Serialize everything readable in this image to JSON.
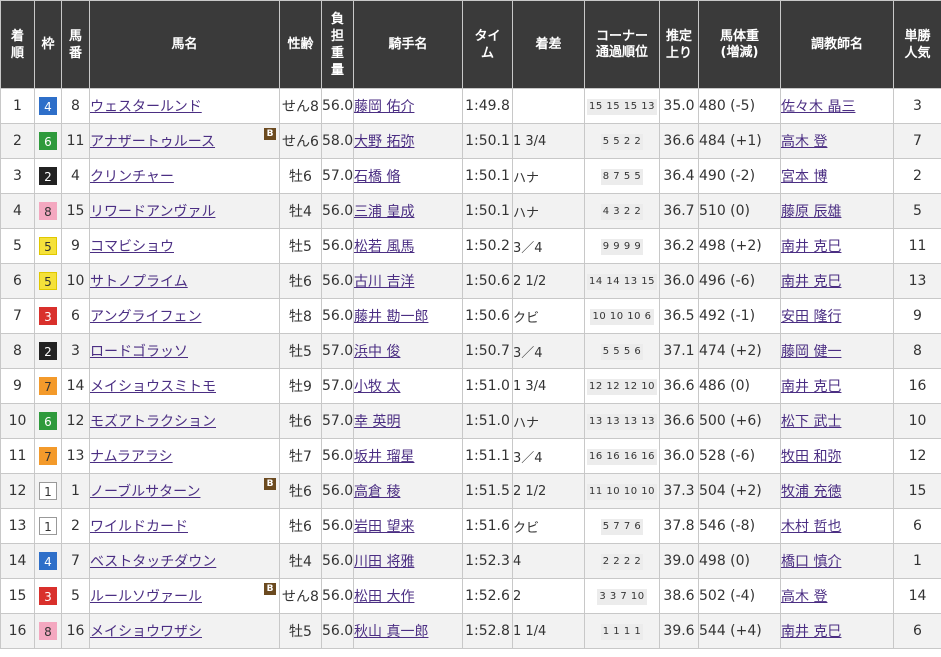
{
  "headers": {
    "finish": "着順",
    "frame": "枠",
    "number": "馬番",
    "horse": "馬名",
    "sex_age": "性齢",
    "weight": "負担重量",
    "jockey": "騎手名",
    "time": "タイム",
    "margin": "着差",
    "passing_line1": "コーナー",
    "passing_line2": "通過順位",
    "last3f": "推定上り",
    "body_line1": "馬体重",
    "body_line2": "(増減)",
    "trainer": "調教師名",
    "popularity": "単勝人気"
  },
  "frame_colors": {
    "1": {
      "bg": "#ffffff",
      "fg": "#333333",
      "border": "#999999"
    },
    "2": {
      "bg": "#222222",
      "fg": "#ffffff",
      "border": "#222222"
    },
    "3": {
      "bg": "#d9302c",
      "fg": "#ffffff",
      "border": "#d9302c"
    },
    "4": {
      "bg": "#2e6fc9",
      "fg": "#ffffff",
      "border": "#2e6fc9"
    },
    "5": {
      "bg": "#f5e13a",
      "fg": "#333333",
      "border": "#e0c800"
    },
    "6": {
      "bg": "#2e9a3c",
      "fg": "#ffffff",
      "border": "#2e9a3c"
    },
    "7": {
      "bg": "#f39a2b",
      "fg": "#333333",
      "border": "#f39a2b"
    },
    "8": {
      "bg": "#f4a8c0",
      "fg": "#333333",
      "border": "#f4a8c0"
    }
  },
  "blinker_label": "B",
  "rows": [
    {
      "finish": "1",
      "frame": "4",
      "number": "8",
      "horse": "ウェスタールンド",
      "blinker": false,
      "sex_age": "せん8",
      "weight": "56.0",
      "jockey": "藤岡 佑介",
      "time": "1:49.8",
      "margin": "",
      "passing": "15 15 15 13",
      "last3f": "35.0",
      "body": "480 (-5)",
      "trainer": "佐々木 晶三",
      "popularity": "3"
    },
    {
      "finish": "2",
      "frame": "6",
      "number": "11",
      "horse": "アナザートゥルース",
      "blinker": true,
      "sex_age": "せん6",
      "weight": "58.0",
      "jockey": "大野 拓弥",
      "time": "1:50.1",
      "margin": "1 3/4",
      "passing": "5 5 2 2",
      "last3f": "36.6",
      "body": "484 (+1)",
      "trainer": "高木 登",
      "popularity": "7"
    },
    {
      "finish": "3",
      "frame": "2",
      "number": "4",
      "horse": "クリンチャー",
      "blinker": false,
      "sex_age": "牡6",
      "weight": "57.0",
      "jockey": "石橋 脩",
      "time": "1:50.1",
      "margin": "ハナ",
      "passing": "8 7 5 5",
      "last3f": "36.4",
      "body": "490 (-2)",
      "trainer": "宮本 博",
      "popularity": "2"
    },
    {
      "finish": "4",
      "frame": "8",
      "number": "15",
      "horse": "リワードアンヴァル",
      "blinker": false,
      "sex_age": "牡4",
      "weight": "56.0",
      "jockey": "三浦 皇成",
      "time": "1:50.1",
      "margin": "ハナ",
      "passing": "4 3 2 2",
      "last3f": "36.7",
      "body": "510 (0)",
      "trainer": "藤原 辰雄",
      "popularity": "5"
    },
    {
      "finish": "5",
      "frame": "5",
      "number": "9",
      "horse": "コマビショウ",
      "blinker": false,
      "sex_age": "牡5",
      "weight": "56.0",
      "jockey": "松若 風馬",
      "time": "1:50.2",
      "margin": "3／4",
      "passing": "9 9 9 9",
      "last3f": "36.2",
      "body": "498 (+2)",
      "trainer": "南井 克巳",
      "popularity": "11"
    },
    {
      "finish": "6",
      "frame": "5",
      "number": "10",
      "horse": "サトノプライム",
      "blinker": false,
      "sex_age": "牡6",
      "weight": "56.0",
      "jockey": "古川 吉洋",
      "time": "1:50.6",
      "margin": "2 1/2",
      "passing": "14 14 13 15",
      "last3f": "36.0",
      "body": "496 (-6)",
      "trainer": "南井 克巳",
      "popularity": "13"
    },
    {
      "finish": "7",
      "frame": "3",
      "number": "6",
      "horse": "アングライフェン",
      "blinker": false,
      "sex_age": "牡8",
      "weight": "56.0",
      "jockey": "藤井 勘一郎",
      "time": "1:50.6",
      "margin": "クビ",
      "passing": "10 10 10 6",
      "last3f": "36.5",
      "body": "492 (-1)",
      "trainer": "安田 隆行",
      "popularity": "9"
    },
    {
      "finish": "8",
      "frame": "2",
      "number": "3",
      "horse": "ロードゴラッソ",
      "blinker": false,
      "sex_age": "牡5",
      "weight": "57.0",
      "jockey": "浜中 俊",
      "time": "1:50.7",
      "margin": "3／4",
      "passing": "5 5 5 6",
      "last3f": "37.1",
      "body": "474 (+2)",
      "trainer": "藤岡 健一",
      "popularity": "8"
    },
    {
      "finish": "9",
      "frame": "7",
      "number": "14",
      "horse": "メイショウスミトモ",
      "blinker": false,
      "sex_age": "牡9",
      "weight": "57.0",
      "jockey": "小牧 太",
      "time": "1:51.0",
      "margin": "1 3/4",
      "passing": "12 12 12 10",
      "last3f": "36.6",
      "body": "486 (0)",
      "trainer": "南井 克巳",
      "popularity": "16"
    },
    {
      "finish": "10",
      "frame": "6",
      "number": "12",
      "horse": "モズアトラクション",
      "blinker": false,
      "sex_age": "牡6",
      "weight": "57.0",
      "jockey": "幸 英明",
      "time": "1:51.0",
      "margin": "ハナ",
      "passing": "13 13 13 13",
      "last3f": "36.6",
      "body": "500 (+6)",
      "trainer": "松下 武士",
      "popularity": "10"
    },
    {
      "finish": "11",
      "frame": "7",
      "number": "13",
      "horse": "ナムラアラシ",
      "blinker": false,
      "sex_age": "牡7",
      "weight": "56.0",
      "jockey": "坂井 瑠星",
      "time": "1:51.1",
      "margin": "3／4",
      "passing": "16 16 16 16",
      "last3f": "36.0",
      "body": "528 (-6)",
      "trainer": "牧田 和弥",
      "popularity": "12"
    },
    {
      "finish": "12",
      "frame": "1",
      "number": "1",
      "horse": "ノーブルサターン",
      "blinker": true,
      "sex_age": "牡6",
      "weight": "56.0",
      "jockey": "高倉 稜",
      "time": "1:51.5",
      "margin": "2 1/2",
      "passing": "11 10 10 10",
      "last3f": "37.3",
      "body": "504 (+2)",
      "trainer": "牧浦 充徳",
      "popularity": "15"
    },
    {
      "finish": "13",
      "frame": "1",
      "number": "2",
      "horse": "ワイルドカード",
      "blinker": false,
      "sex_age": "牡6",
      "weight": "56.0",
      "jockey": "岩田 望来",
      "time": "1:51.6",
      "margin": "クビ",
      "passing": "5 7 7 6",
      "last3f": "37.8",
      "body": "546 (-8)",
      "trainer": "木村 哲也",
      "popularity": "6"
    },
    {
      "finish": "14",
      "frame": "4",
      "number": "7",
      "horse": "ベストタッチダウン",
      "blinker": false,
      "sex_age": "牡4",
      "weight": "56.0",
      "jockey": "川田 将雅",
      "time": "1:52.3",
      "margin": "4",
      "passing": "2 2 2 2",
      "last3f": "39.0",
      "body": "498 (0)",
      "trainer": "橋口 慎介",
      "popularity": "1"
    },
    {
      "finish": "15",
      "frame": "3",
      "number": "5",
      "horse": "ルールソヴァール",
      "blinker": true,
      "sex_age": "せん8",
      "weight": "56.0",
      "jockey": "松田 大作",
      "time": "1:52.6",
      "margin": "2",
      "passing": "3 3 7 10",
      "last3f": "38.6",
      "body": "502 (-4)",
      "trainer": "高木 登",
      "popularity": "14"
    },
    {
      "finish": "16",
      "frame": "8",
      "number": "16",
      "horse": "メイショウワザシ",
      "blinker": false,
      "sex_age": "牡5",
      "weight": "56.0",
      "jockey": "秋山 真一郎",
      "time": "1:52.8",
      "margin": "1 1/4",
      "passing": "1 1 1 1",
      "last3f": "39.6",
      "body": "544 (+4)",
      "trainer": "南井 克巳",
      "popularity": "6"
    }
  ]
}
